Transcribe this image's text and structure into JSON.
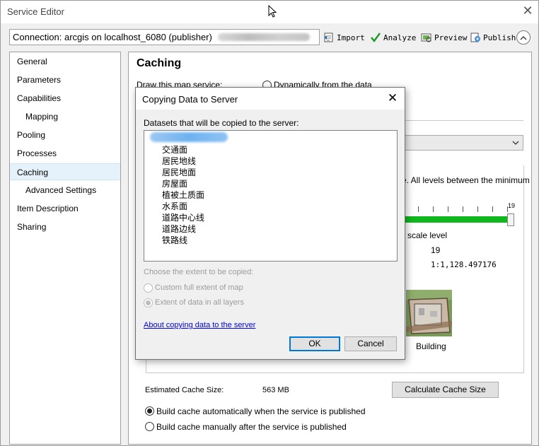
{
  "window": {
    "title": "Service Editor",
    "close_glyph": "✕"
  },
  "connection": {
    "text": "Connection: arcgis on localhost_6080 (publisher)"
  },
  "toolbar": {
    "import": "Import",
    "analyze": "Analyze",
    "preview": "Preview",
    "publish": "Publish"
  },
  "nav": {
    "items": [
      {
        "label": "General"
      },
      {
        "label": "Parameters"
      },
      {
        "label": "Capabilities"
      },
      {
        "label": "Mapping"
      },
      {
        "label": "Pooling"
      },
      {
        "label": "Processes"
      },
      {
        "label": "Caching"
      },
      {
        "label": "Advanced Settings"
      },
      {
        "label": "Item Description"
      },
      {
        "label": "Sharing"
      }
    ],
    "active": "Caching"
  },
  "caching": {
    "title": "Caching",
    "draw_label": "Draw this map service:",
    "dynamic_option": "Dynamically from the data",
    "scale_desc": "e. All levels between the minimum",
    "slider_max": "19",
    "scale_level_label": "scale level",
    "level_value": "19",
    "scale_value": "1:1,128.497176",
    "thumbnail_label": "Building",
    "est_label": "Estimated Cache Size:",
    "est_value": "563 MB",
    "calc_button": "Calculate Cache Size",
    "build_auto": "Build cache automatically when the service is published",
    "build_manual": "Build cache manually after the service is published"
  },
  "dialog": {
    "title": "Copying Data to Server",
    "close_glyph": "✕",
    "datasets_label": "Datasets that will be copied to the server:",
    "datasets": [
      "交通面",
      "居民地线",
      "居民地面",
      "房屋面",
      "植被土质面",
      "水系面",
      "道路中心线",
      "道路边线",
      "铁路线"
    ],
    "extent_label": "Choose the extent to be copied:",
    "extent_custom": "Custom full extent of map",
    "extent_layers": "Extent of data in all layers",
    "help_link": "About copying data to the server",
    "ok": "OK",
    "cancel": "Cancel"
  },
  "colors": {
    "slider_fill": "#0fb81d",
    "link": "#0000ee",
    "accent_focus": "#0078d7"
  }
}
